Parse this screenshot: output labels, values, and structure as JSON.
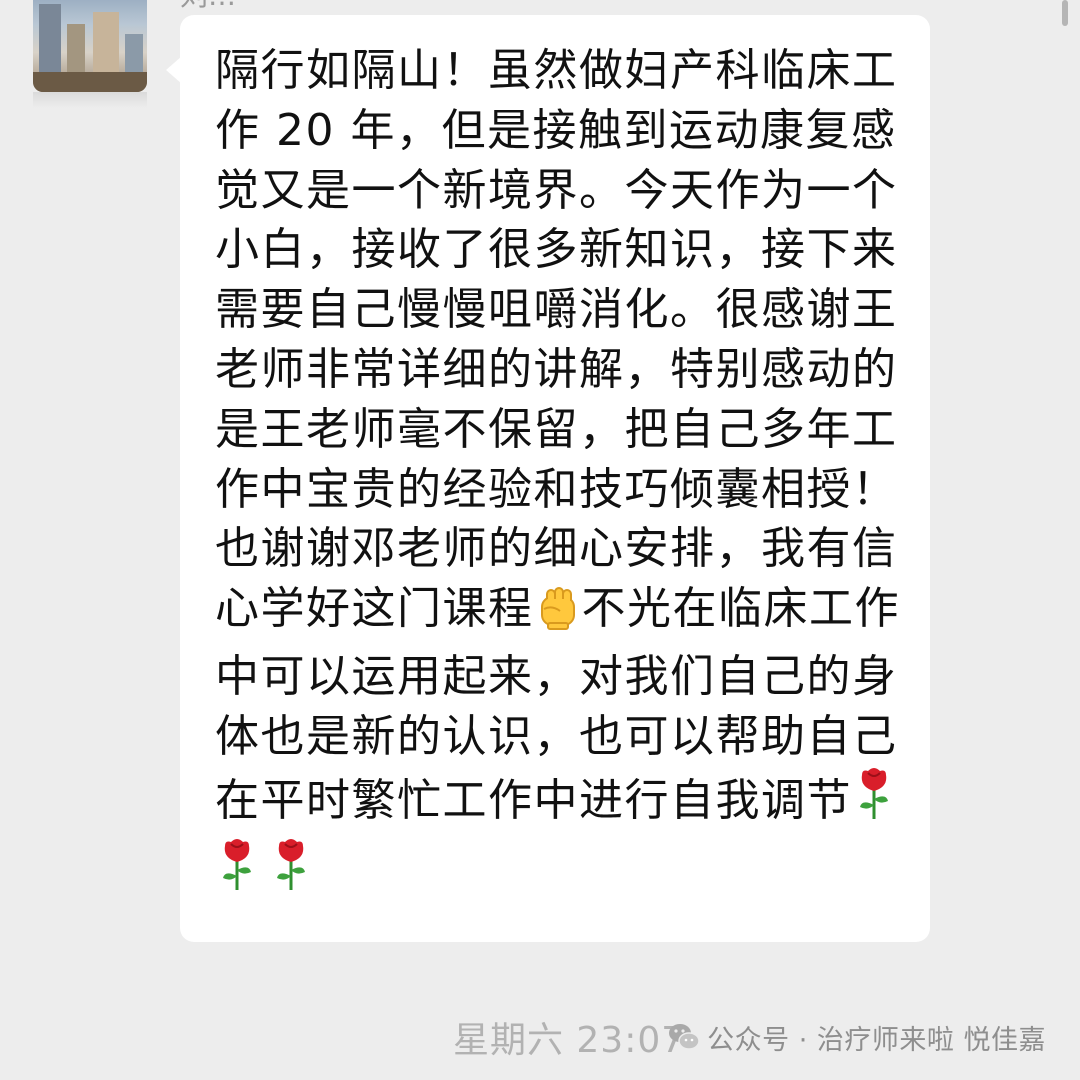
{
  "chat": {
    "sender_name": "刘…",
    "message": {
      "text_before_fist": "隔行如隔山！虽然做妇产科临床工作 20 年，但是接触到运动康复感觉又是一个新境界。今天作为一个小白，接收了很多新知识，接下来需要自己慢慢咀嚼消化。很感谢王老师非常详细的讲解，特别感动的是王老师毫不保留，把自己多年工作中宝贵的经验和技巧倾囊相授！也谢谢邓老师的细心安排，我有信心学好这门课程",
      "text_after_fist": "不光在临床工作中可以运用起来，对我们自己的身体也是新的认识，也可以帮助自己在平时繁忙工作中进行自我调节",
      "emojis": [
        "raised-fist-icon",
        "rose-icon",
        "rose-icon",
        "rose-icon"
      ]
    },
    "timestamp": "星期六 23:07",
    "colors": {
      "background": "#ededed",
      "bubble": "#ffffff",
      "text": "#111111",
      "timestamp": "#b2b2b2"
    }
  },
  "watermark": {
    "text": "公众号 · 治疗师来啦 悦佳嘉",
    "icon": "wechat-logo-icon"
  }
}
